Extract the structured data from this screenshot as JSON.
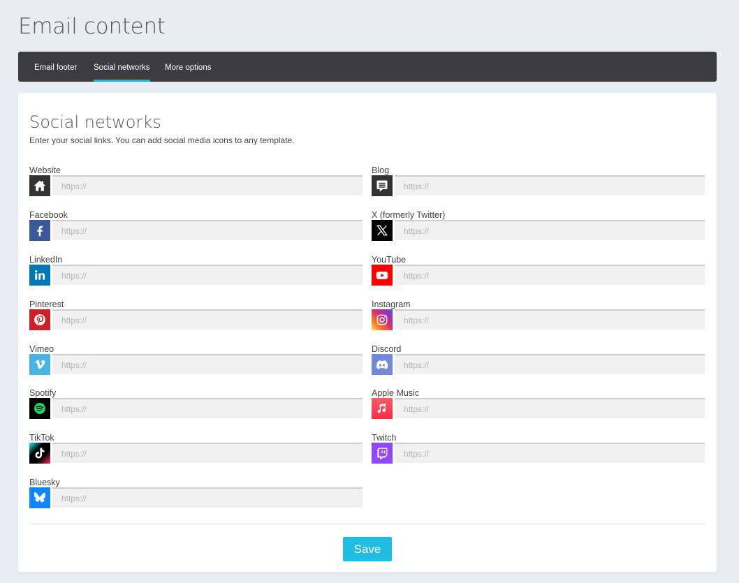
{
  "page_title": "Email content",
  "tabs": [
    {
      "label": "Email footer"
    },
    {
      "label": "Social networks"
    },
    {
      "label": "More options"
    }
  ],
  "card": {
    "title": "Social networks",
    "subtitle": "Enter your social links. You can add social media icons to any template."
  },
  "fields": {
    "website": {
      "label": "Website",
      "placeholder": "https://",
      "value": "",
      "icon": "home-icon",
      "color": "#333333"
    },
    "blog": {
      "label": "Blog",
      "placeholder": "https://",
      "value": "",
      "icon": "blog-icon",
      "color": "#333333"
    },
    "facebook": {
      "label": "Facebook",
      "placeholder": "https://",
      "value": "",
      "icon": "facebook-icon",
      "color": "#3b5998"
    },
    "x": {
      "label": "X (formerly Twitter)",
      "placeholder": "https://",
      "value": "",
      "icon": "x-icon",
      "color": "#000000"
    },
    "linkedin": {
      "label": "LinkedIn",
      "placeholder": "https://",
      "value": "",
      "icon": "linkedin-icon",
      "color": "#0077b5"
    },
    "youtube": {
      "label": "YouTube",
      "placeholder": "https://",
      "value": "",
      "icon": "youtube-icon",
      "color": "#ff0000"
    },
    "pinterest": {
      "label": "Pinterest",
      "placeholder": "https://",
      "value": "",
      "icon": "pinterest-icon",
      "color": "#cb2027"
    },
    "instagram": {
      "label": "Instagram",
      "placeholder": "https://",
      "value": "",
      "icon": "instagram-icon",
      "color": "#c13584"
    },
    "vimeo": {
      "label": "Vimeo",
      "placeholder": "https://",
      "value": "",
      "icon": "vimeo-icon",
      "color": "#4ab3e6"
    },
    "discord": {
      "label": "Discord",
      "placeholder": "https://",
      "value": "",
      "icon": "discord-icon",
      "color": "#7289da"
    },
    "spotify": {
      "label": "Spotify",
      "placeholder": "https://",
      "value": "",
      "icon": "spotify-icon",
      "color": "#000000"
    },
    "apple_music": {
      "label": "Apple Music",
      "placeholder": "https://",
      "value": "",
      "icon": "apple-music-icon",
      "color": "#f94c57"
    },
    "tiktok": {
      "label": "TikTok",
      "placeholder": "https://",
      "value": "",
      "icon": "tiktok-icon",
      "color": "#000000"
    },
    "twitch": {
      "label": "Twitch",
      "placeholder": "https://",
      "value": "",
      "icon": "twitch-icon",
      "color": "#9146ff"
    },
    "bluesky": {
      "label": "Bluesky",
      "placeholder": "https://",
      "value": "",
      "icon": "bluesky-icon",
      "color": "#1185fe"
    }
  },
  "save_label": "Save",
  "accent_color": "#1fbde3"
}
